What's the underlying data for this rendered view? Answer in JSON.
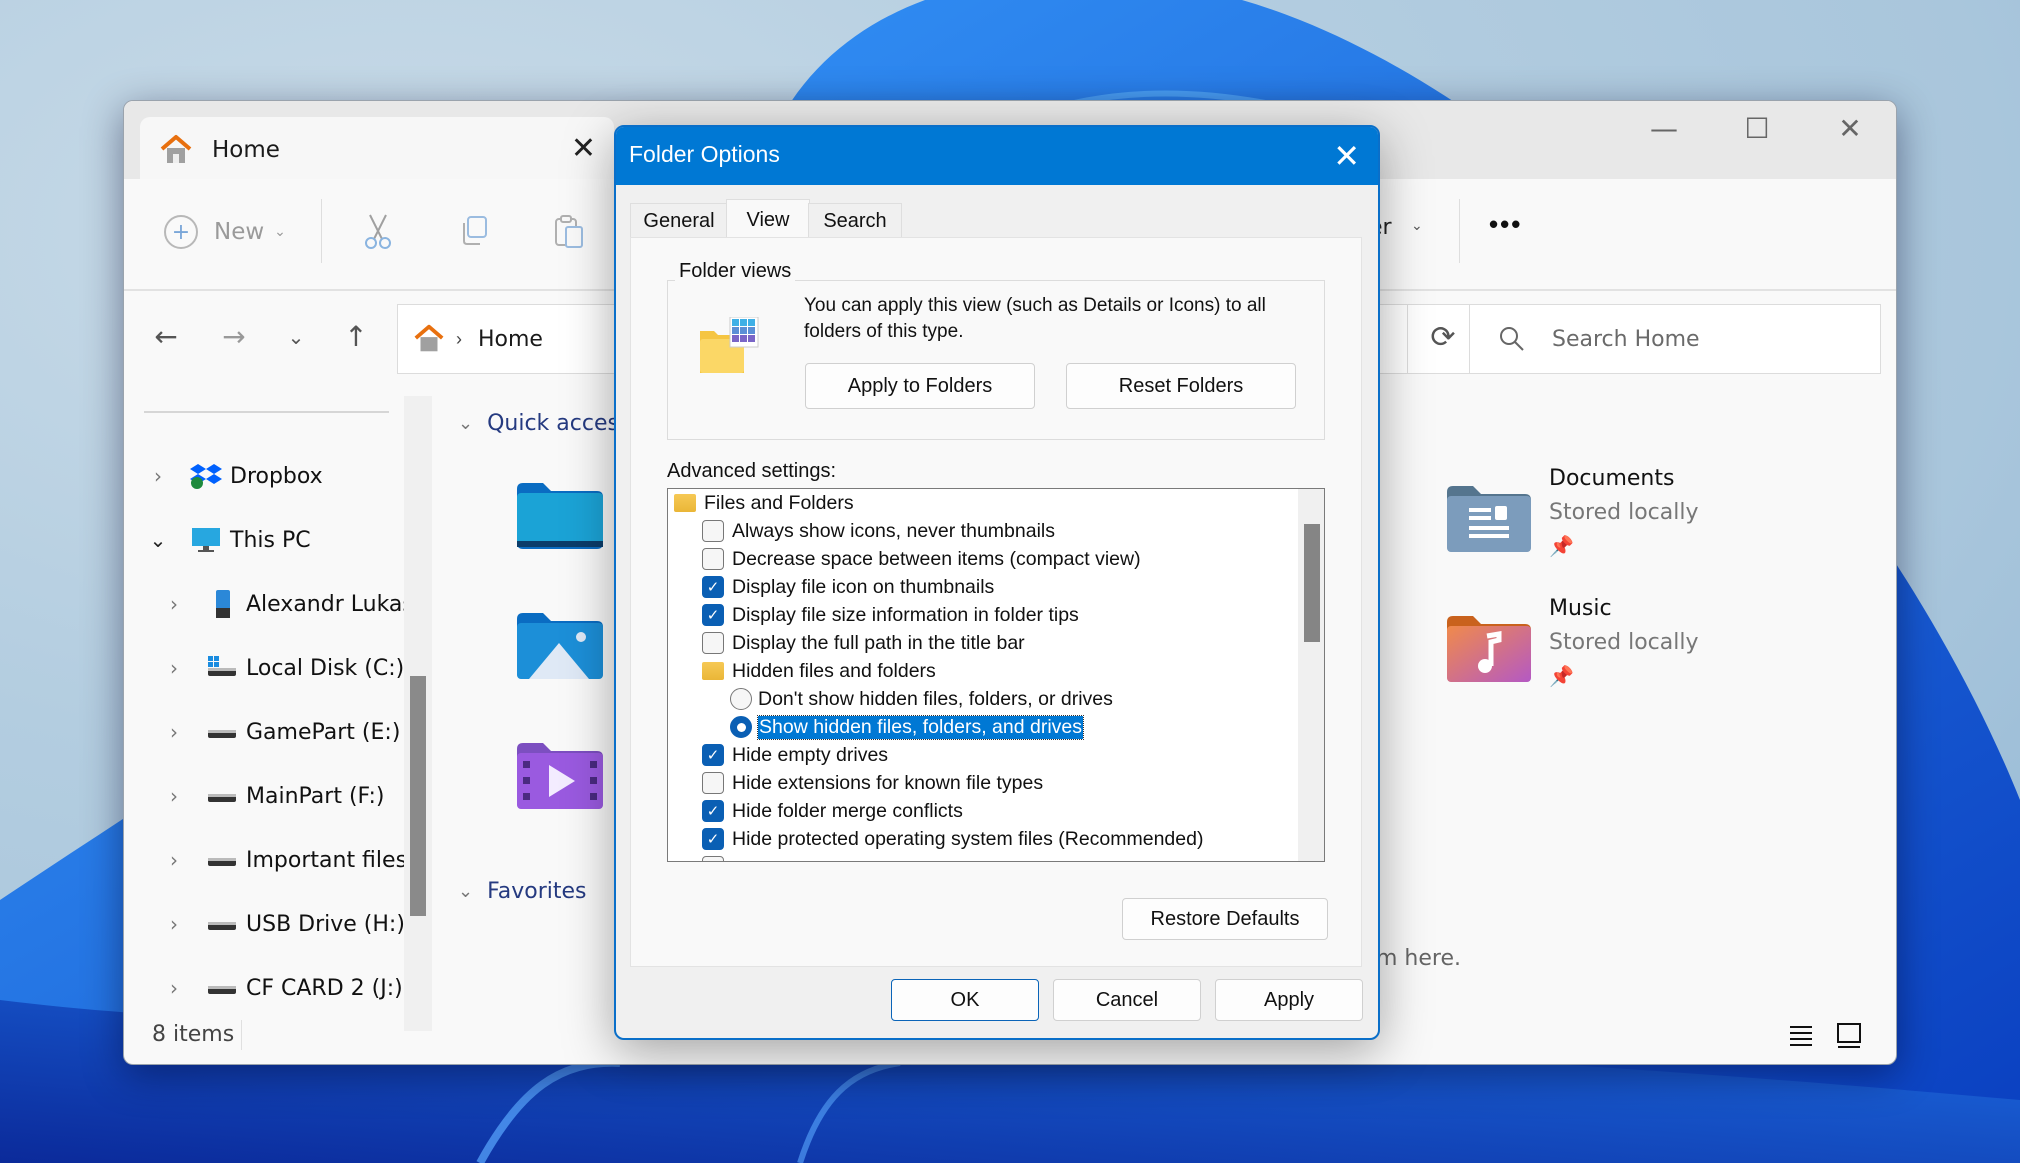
{
  "explorer": {
    "tab_title": "Home",
    "toolbar": {
      "new_label": "New",
      "partial_label": "er",
      "more_label": "•••"
    },
    "address": {
      "location": "Home"
    },
    "search": {
      "placeholder": "Search Home"
    },
    "sidebar": {
      "items": [
        {
          "label": "Dropbox",
          "icon": "dropbox-icon",
          "expanded": false
        },
        {
          "label": "This PC",
          "icon": "computer-icon",
          "expanded": true
        },
        {
          "label": "Alexandr Lukas",
          "icon": "phone-icon",
          "expanded": false
        },
        {
          "label": "Local Disk (C:)",
          "icon": "system-drive-icon",
          "expanded": false
        },
        {
          "label": "GamePart (E:)",
          "icon": "drive-icon",
          "expanded": false
        },
        {
          "label": "MainPart (F:)",
          "icon": "drive-icon",
          "expanded": false
        },
        {
          "label": "Important files",
          "icon": "drive-icon",
          "expanded": false
        },
        {
          "label": "USB Drive (H:)",
          "icon": "drive-icon",
          "expanded": false
        },
        {
          "label": "CF CARD 2 (J:)",
          "icon": "drive-icon",
          "expanded": false
        }
      ]
    },
    "content": {
      "quick_access_label": "Quick access",
      "favorites_label": "Favorites",
      "favorites_hint_partial": "m here.",
      "pinned": [
        {
          "name": "Documents",
          "sub": "Stored locally",
          "icon": "documents-folder-icon"
        },
        {
          "name": "Music",
          "sub": "Stored locally",
          "icon": "music-folder-icon"
        }
      ]
    },
    "status": {
      "items_count": "8 items"
    }
  },
  "dialog": {
    "title": "Folder Options",
    "tabs": [
      "General",
      "View",
      "Search"
    ],
    "active_tab": "View",
    "folder_views": {
      "label": "Folder views",
      "description": "You can apply this view (such as Details or Icons) to all folders of this type.",
      "apply_button": "Apply to Folders",
      "reset_button": "Reset Folders"
    },
    "advanced_label": "Advanced settings:",
    "tree": [
      {
        "type": "folder",
        "level": 0,
        "label": "Files and Folders"
      },
      {
        "type": "checkbox",
        "level": 1,
        "label": "Always show icons, never thumbnails",
        "checked": false
      },
      {
        "type": "checkbox",
        "level": 1,
        "label": "Decrease space between items (compact view)",
        "checked": false
      },
      {
        "type": "checkbox",
        "level": 1,
        "label": "Display file icon on thumbnails",
        "checked": true
      },
      {
        "type": "checkbox",
        "level": 1,
        "label": "Display file size information in folder tips",
        "checked": true
      },
      {
        "type": "checkbox",
        "level": 1,
        "label": "Display the full path in the title bar",
        "checked": false
      },
      {
        "type": "folder",
        "level": 1,
        "label": "Hidden files and folders"
      },
      {
        "type": "radio",
        "level": 2,
        "label": "Don't show hidden files, folders, or drives",
        "checked": false
      },
      {
        "type": "radio",
        "level": 2,
        "label": "Show hidden files, folders, and drives",
        "checked": true,
        "selected": true
      },
      {
        "type": "checkbox",
        "level": 1,
        "label": "Hide empty drives",
        "checked": true
      },
      {
        "type": "checkbox",
        "level": 1,
        "label": "Hide extensions for known file types",
        "checked": false
      },
      {
        "type": "checkbox",
        "level": 1,
        "label": "Hide folder merge conflicts",
        "checked": true
      },
      {
        "type": "checkbox",
        "level": 1,
        "label": "Hide protected operating system files (Recommended)",
        "checked": true
      }
    ],
    "restore_defaults": "Restore Defaults",
    "ok": "OK",
    "cancel": "Cancel",
    "apply": "Apply",
    "accent_color": "#0078d4"
  }
}
